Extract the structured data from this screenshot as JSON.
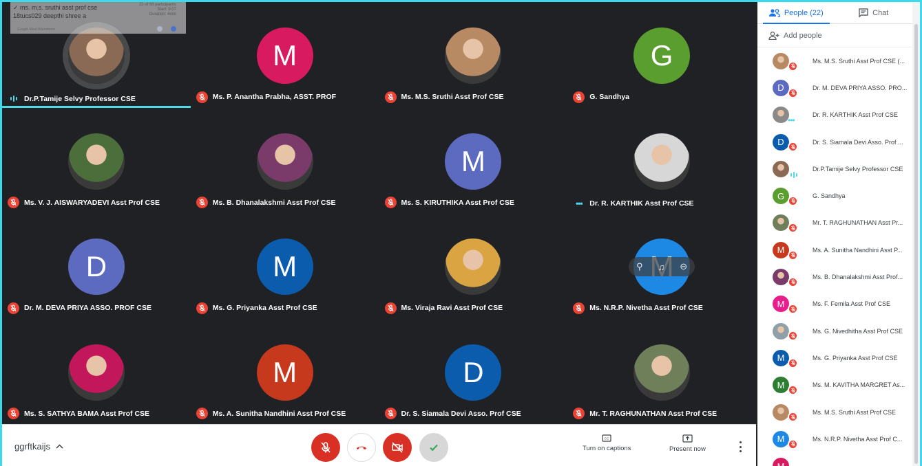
{
  "attendance": {
    "line1": "ms. m.s. sruthi asst prof cse",
    "line2": "18tucs029 deepthi shree a",
    "info": "22 of 68 participants\nStart: 9:07\nDuration: 4min",
    "footer": "Google Meet Attendance"
  },
  "tiles": [
    {
      "name": "Dr.P.Tamije Selvy Professor CSE",
      "initial": "",
      "color": "#8a6a55",
      "status": "speaking",
      "active": true
    },
    {
      "name": "Ms. P. Anantha Prabha, ASST. PROF",
      "initial": "M",
      "color": "#d81b60",
      "status": "muted"
    },
    {
      "name": "Ms. M.S. Sruthi Asst Prof CSE",
      "initial": "",
      "color": "#b88a63",
      "status": "muted"
    },
    {
      "name": "G. Sandhya",
      "initial": "G",
      "color": "#5a9e2f",
      "status": "muted"
    },
    {
      "name": "Ms. V. J. AISWARYADEVI Asst Prof CSE",
      "initial": "",
      "color": "#4b6e3a",
      "status": "muted"
    },
    {
      "name": "Ms. B. Dhanalakshmi Asst Prof CSE",
      "initial": "",
      "color": "#7a3b6a",
      "status": "muted"
    },
    {
      "name": "Ms. S. KIRUTHIKA Asst Prof CSE",
      "initial": "M",
      "color": "#5c6bc0",
      "status": "muted"
    },
    {
      "name": "Dr. R. KARTHIK Asst Prof CSE",
      "initial": "",
      "color": "#d7d7d7",
      "status": "dots"
    },
    {
      "name": "Dr. M. DEVA PRIYA ASSO. PROF CSE",
      "initial": "D",
      "color": "#5c6bc0",
      "status": "muted"
    },
    {
      "name": "Ms. G. Priyanka Asst Prof CSE",
      "initial": "M",
      "color": "#0b5cad",
      "status": "muted"
    },
    {
      "name": "Ms. Viraja Ravi Asst Prof CSE",
      "initial": "",
      "color": "#d9a441",
      "status": "muted"
    },
    {
      "name": "Ms. N.R.P. Nivetha Asst Prof CSE",
      "initial": "M",
      "color": "#1e88e5",
      "status": "muted",
      "hover": true
    },
    {
      "name": "Ms. S. SATHYA BAMA Asst Prof CSE",
      "initial": "",
      "color": "#c2185b",
      "status": "muted"
    },
    {
      "name": "Ms. A. Sunitha Nandhini Asst Prof CSE",
      "initial": "M",
      "color": "#c6391c",
      "status": "muted"
    },
    {
      "name": "Dr. S. Siamala Devi Asso. Prof CSE",
      "initial": "D",
      "color": "#0b5cad",
      "status": "muted"
    },
    {
      "name": "Mr. T. RAGHUNATHAN Asst Prof CSE",
      "initial": "",
      "color": "#6f7f5a",
      "status": "muted"
    }
  ],
  "panel": {
    "people_tab": "People (22)",
    "chat_tab": "Chat",
    "add_people": "Add people",
    "participants": [
      {
        "name": "Ms. M.S. Sruthi Asst Prof CSE (...",
        "initial": "",
        "color": "#b88a63",
        "status": "muted"
      },
      {
        "name": "Dr. M. DEVA PRIYA ASSO. PRO...",
        "initial": "D",
        "color": "#5c6bc0",
        "status": "muted"
      },
      {
        "name": "Dr. R. KARTHIK Asst Prof CSE",
        "initial": "",
        "color": "#8a8a8a",
        "status": "dots"
      },
      {
        "name": "Dr. S. Siamala Devi Asso. Prof ...",
        "initial": "D",
        "color": "#0b5cad",
        "status": "muted"
      },
      {
        "name": "Dr.P.Tamije Selvy Professor CSE",
        "initial": "",
        "color": "#8a6a55",
        "status": "speaking"
      },
      {
        "name": "G. Sandhya",
        "initial": "G",
        "color": "#5a9e2f",
        "status": "muted"
      },
      {
        "name": "Mr. T. RAGHUNATHAN Asst Pr...",
        "initial": "",
        "color": "#6f7f5a",
        "status": "muted"
      },
      {
        "name": "Ms. A. Sunitha Nandhini Asst P...",
        "initial": "M",
        "color": "#c6391c",
        "status": "muted"
      },
      {
        "name": "Ms. B. Dhanalakshmi Asst Prof...",
        "initial": "",
        "color": "#7a3b6a",
        "status": "muted"
      },
      {
        "name": "Ms. F. Femila Asst Prof CSE",
        "initial": "M",
        "color": "#e91e8c",
        "status": "muted"
      },
      {
        "name": "Ms. G. Nivedhitha Asst Prof CSE",
        "initial": "",
        "color": "#8fa0a8",
        "status": "muted"
      },
      {
        "name": "Ms. G. Priyanka Asst Prof CSE",
        "initial": "M",
        "color": "#0b5cad",
        "status": "muted"
      },
      {
        "name": "Ms. M. KAVITHA MARGRET As...",
        "initial": "M",
        "color": "#2e7d32",
        "status": "muted"
      },
      {
        "name": "Ms. M.S. Sruthi Asst Prof CSE",
        "initial": "",
        "color": "#b88a63",
        "status": "muted"
      },
      {
        "name": "Ms. N.R.P. Nivetha Asst Prof C...",
        "initial": "M",
        "color": "#1e88e5",
        "status": "muted"
      },
      {
        "name": "",
        "initial": "M",
        "color": "#d81b60",
        "status": "muted"
      }
    ]
  },
  "bottombar": {
    "meeting_code": "ggrftkaijs",
    "captions_label": "Turn on captions",
    "present_label": "Present now"
  }
}
